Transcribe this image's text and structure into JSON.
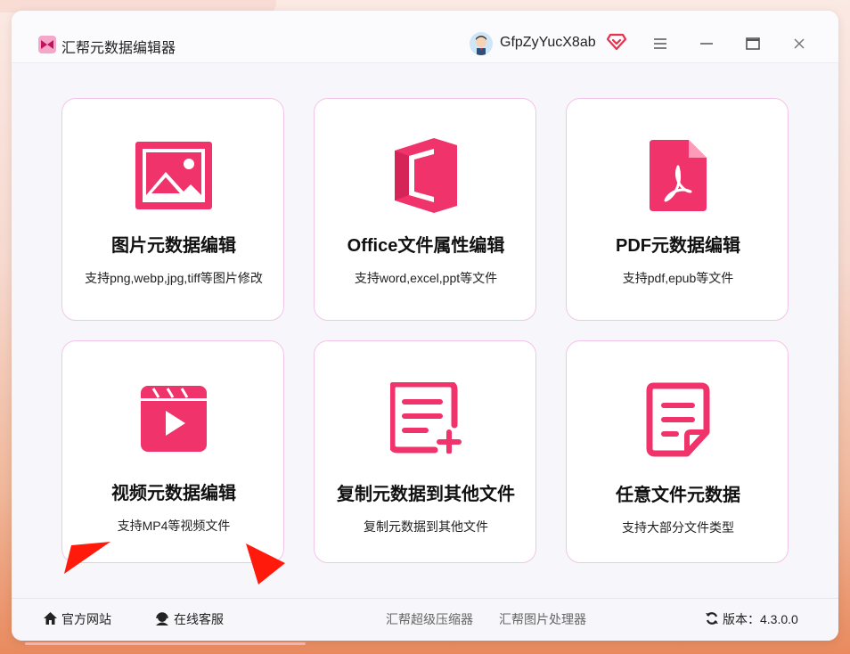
{
  "app": {
    "title": "汇帮元数据编辑器"
  },
  "user": {
    "name": "GfpZyYucX8ab"
  },
  "icons": {
    "logo": "app-logo-icon",
    "vip": "diamond-vip-icon",
    "menu": "hamburger-menu-icon",
    "minimize": "minimize-icon",
    "maximize": "maximize-icon",
    "close": "close-icon"
  },
  "cards": [
    {
      "title": "图片元数据编辑",
      "desc": "支持png,webp,jpg,tiff等图片修改",
      "icon": "image-icon"
    },
    {
      "title": "Office文件属性编辑",
      "desc": "支持word,excel,ppt等文件",
      "icon": "office-icon"
    },
    {
      "title": "PDF元数据编辑",
      "desc": "支持pdf,epub等文件",
      "icon": "pdf-file-icon"
    },
    {
      "title": "视频元数据编辑",
      "desc": "支持MP4等视频文件",
      "icon": "video-clapper-icon"
    },
    {
      "title": "复制元数据到其他文件",
      "desc": "复制元数据到其他文件",
      "icon": "document-add-icon"
    },
    {
      "title": "任意文件元数据",
      "desc": "支持大部分文件类型",
      "icon": "document-icon"
    }
  ],
  "footer": {
    "website": "官方网站",
    "service": "在线客服",
    "link1": "汇帮超级压缩器",
    "link2": "汇帮图片处理器",
    "version": "版本：4.3.0.0"
  },
  "colors": {
    "accent": "#f0336a",
    "card_border": "#f2c5e8",
    "window_bg": "#f6f6fb"
  }
}
